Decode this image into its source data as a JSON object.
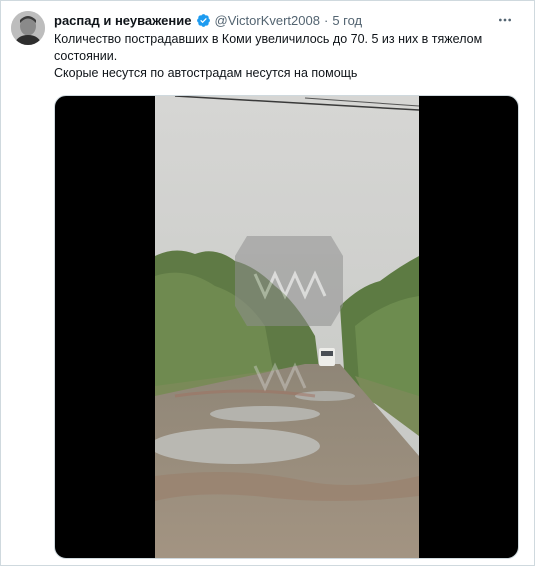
{
  "tweet": {
    "author_name": "распад и неуважение",
    "handle": "@VictorKvert2008",
    "separator": "·",
    "time": "5 год",
    "text_line1": "Количество пострадавших в Коми увеличилось до 70. 5 из них  в тяжелом состоянии.",
    "text_line2": "Скорые несутся по автострадам несутся на помощь"
  },
  "icons": {
    "verified": "verified-badge-icon",
    "more": "more-options-icon",
    "watermark": "video-watermark-logo"
  },
  "colors": {
    "accent": "#1d9bf0",
    "text": "#0f1419",
    "muted": "#536471",
    "border": "#cfd9de",
    "letterbox": "#000000"
  }
}
